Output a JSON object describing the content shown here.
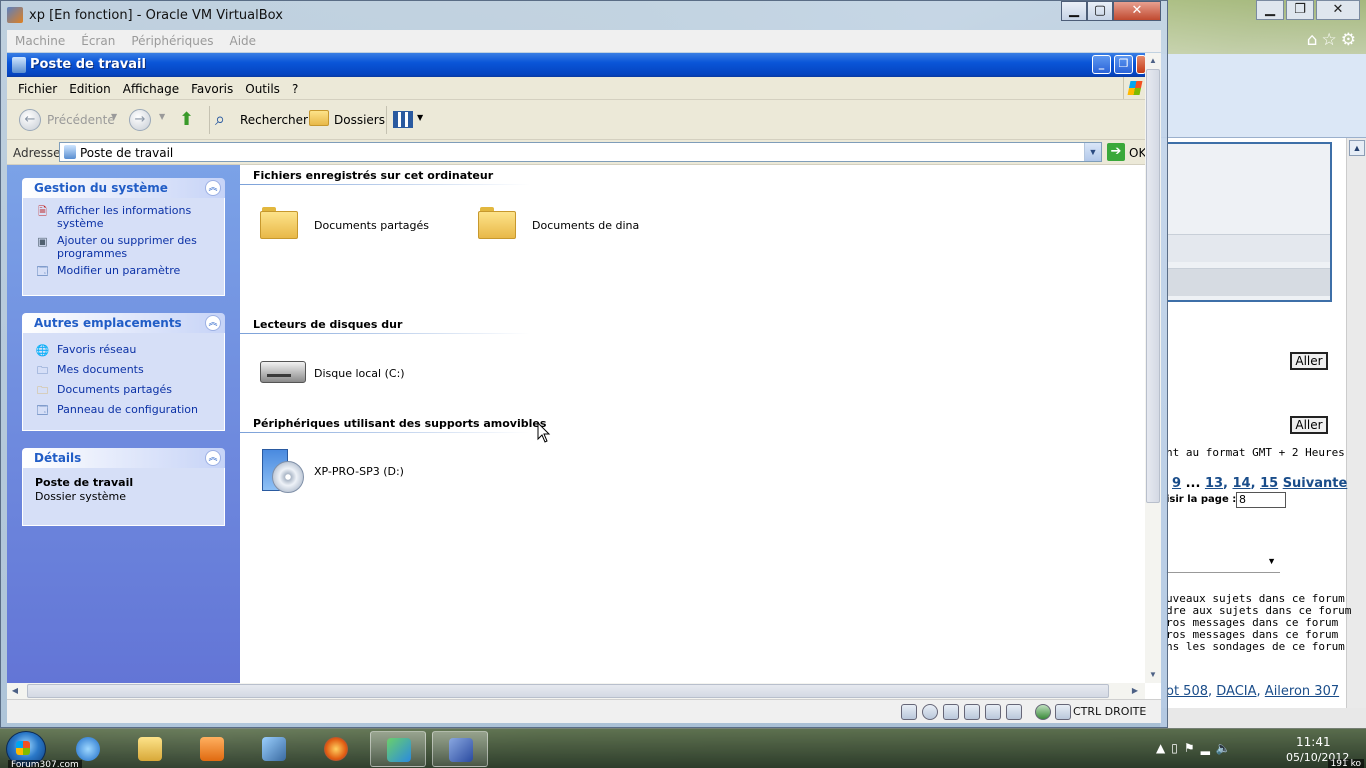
{
  "vbox": {
    "title": "xp [En fonction] - Oracle VM VirtualBox",
    "menu": [
      "Machine",
      "Écran",
      "Périphériques",
      "Aide"
    ],
    "host_key": "CTRL DROITE"
  },
  "explorer": {
    "title": "Poste de travail",
    "menu": [
      "Fichier",
      "Edition",
      "Affichage",
      "Favoris",
      "Outils",
      "?"
    ],
    "toolbar": {
      "back": "Précédente",
      "search": "Rechercher",
      "folders": "Dossiers"
    },
    "address": {
      "label": "Adresse",
      "value": "Poste de travail",
      "go": "OK"
    },
    "taskpane": {
      "system": {
        "title": "Gestion du système",
        "items": [
          {
            "label": "Afficher les informations système",
            "icon": "info-doc-icon"
          },
          {
            "label": "Ajouter ou supprimer des programmes",
            "icon": "add-remove-icon"
          },
          {
            "label": "Modifier un paramètre",
            "icon": "control-panel-icon"
          }
        ]
      },
      "places": {
        "title": "Autres emplacements",
        "items": [
          {
            "label": "Favoris réseau",
            "icon": "network-icon"
          },
          {
            "label": "Mes documents",
            "icon": "my-documents-icon"
          },
          {
            "label": "Documents partagés",
            "icon": "folder-icon"
          },
          {
            "label": "Panneau de configuration",
            "icon": "control-panel-icon"
          }
        ]
      },
      "details": {
        "title": "Détails",
        "name": "Poste de travail",
        "type": "Dossier système"
      }
    },
    "groups": [
      {
        "title": "Fichiers enregistrés sur cet ordinateur",
        "items": [
          {
            "label": "Documents partagés",
            "icon": "folder-icon"
          },
          {
            "label": "Documents de dina",
            "icon": "folder-icon"
          }
        ]
      },
      {
        "title": "Lecteurs de disques dur",
        "items": [
          {
            "label": "Disque local (C:)",
            "icon": "hard-disk-icon"
          }
        ]
      },
      {
        "title": "Périphériques utilisant des supports amovibles",
        "items": [
          {
            "label": "XP-PRO-SP3 (D:)",
            "icon": "cd-drive-icon"
          }
        ]
      }
    ]
  },
  "background_browser": {
    "timezone_text": "nt au format GMT + 2 Heures",
    "pagination": {
      "p1": "9",
      "dots": "...",
      "p2": "13",
      "p3": "14",
      "p4": "15",
      "next": "Suivante"
    },
    "jump_label": "isir la page :",
    "jump_value": "8",
    "go_label": "Aller",
    "rules": [
      "uveaux sujets dans ce forum",
      "dre aux sujets dans ce forum",
      "ros messages dans ce forum",
      "ros messages dans ce forum",
      "ns les sondages de ce forum"
    ],
    "tags": {
      "t1": "ot 508",
      "t2": "DACIA",
      "t3": "Aileron 307"
    }
  },
  "taskbar": {
    "watermark": "Forum307.com",
    "time": "11:41",
    "date": "05/10/2012",
    "size_badge": "191 ko"
  }
}
